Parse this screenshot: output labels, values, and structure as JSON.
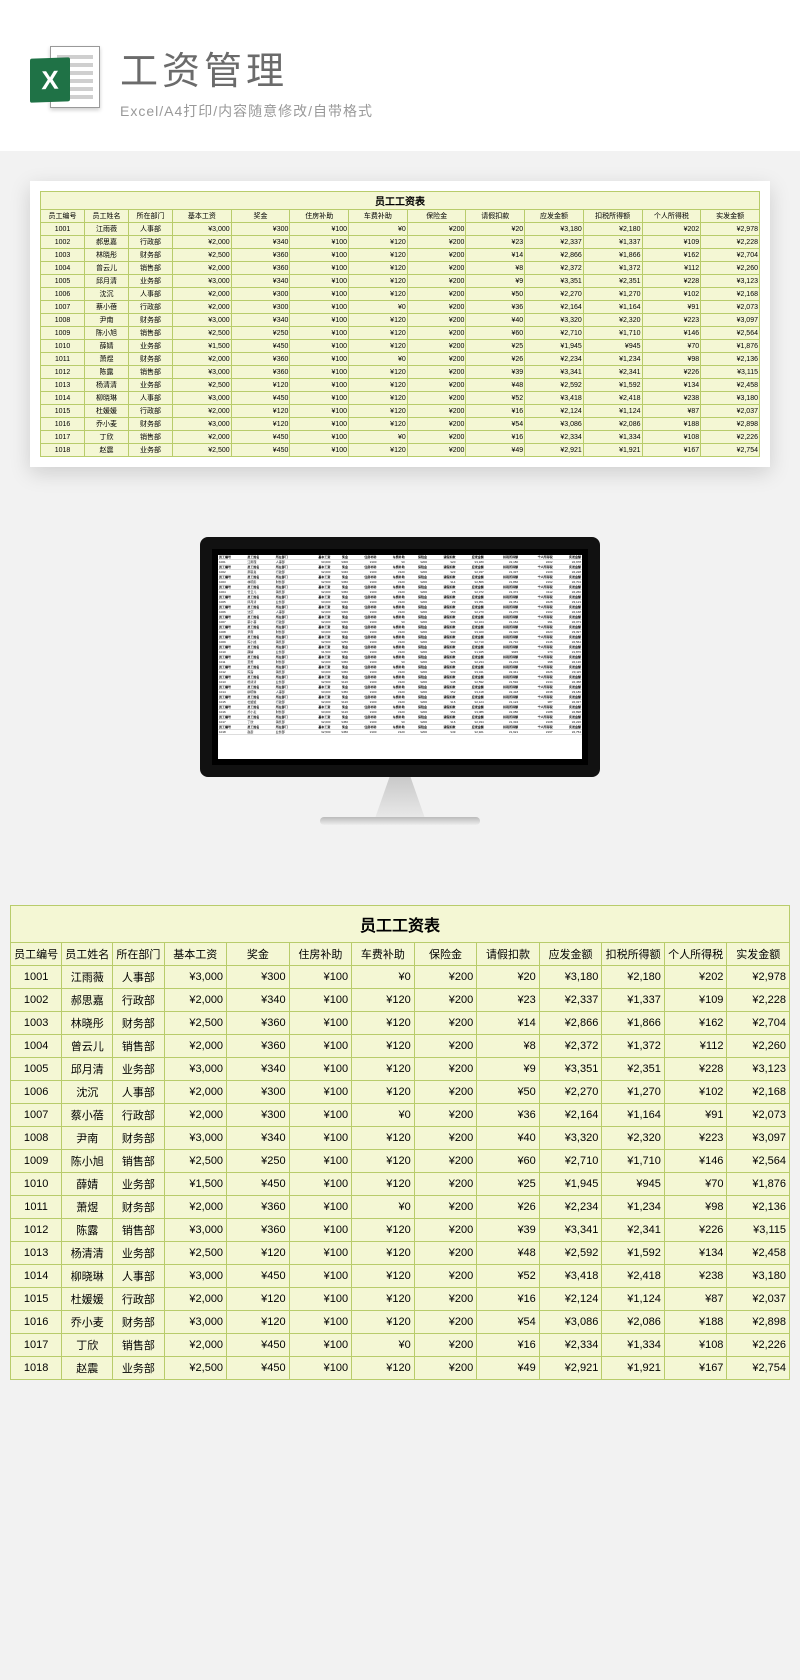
{
  "header": {
    "title": "工资管理",
    "subtitle": "Excel/A4打印/内容随意修改/自带格式",
    "icon_letter": "X"
  },
  "table": {
    "title": "员工工资表",
    "columns": [
      "员工编号",
      "员工姓名",
      "所在部门",
      "基本工资",
      "奖金",
      "住房补助",
      "车费补助",
      "保险金",
      "请假扣款",
      "应发金额",
      "扣税所得额",
      "个人所得税",
      "实发金额"
    ],
    "rows": [
      [
        "1001",
        "江雨薇",
        "人事部",
        "¥3,000",
        "¥300",
        "¥100",
        "¥0",
        "¥200",
        "¥20",
        "¥3,180",
        "¥2,180",
        "¥202",
        "¥2,978"
      ],
      [
        "1002",
        "郝思嘉",
        "行政部",
        "¥2,000",
        "¥340",
        "¥100",
        "¥120",
        "¥200",
        "¥23",
        "¥2,337",
        "¥1,337",
        "¥109",
        "¥2,228"
      ],
      [
        "1003",
        "林晓彤",
        "财务部",
        "¥2,500",
        "¥360",
        "¥100",
        "¥120",
        "¥200",
        "¥14",
        "¥2,866",
        "¥1,866",
        "¥162",
        "¥2,704"
      ],
      [
        "1004",
        "曾云儿",
        "销售部",
        "¥2,000",
        "¥360",
        "¥100",
        "¥120",
        "¥200",
        "¥8",
        "¥2,372",
        "¥1,372",
        "¥112",
        "¥2,260"
      ],
      [
        "1005",
        "邱月清",
        "业务部",
        "¥3,000",
        "¥340",
        "¥100",
        "¥120",
        "¥200",
        "¥9",
        "¥3,351",
        "¥2,351",
        "¥228",
        "¥3,123"
      ],
      [
        "1006",
        "沈沉",
        "人事部",
        "¥2,000",
        "¥300",
        "¥100",
        "¥120",
        "¥200",
        "¥50",
        "¥2,270",
        "¥1,270",
        "¥102",
        "¥2,168"
      ],
      [
        "1007",
        "蔡小蓓",
        "行政部",
        "¥2,000",
        "¥300",
        "¥100",
        "¥0",
        "¥200",
        "¥36",
        "¥2,164",
        "¥1,164",
        "¥91",
        "¥2,073"
      ],
      [
        "1008",
        "尹南",
        "财务部",
        "¥3,000",
        "¥340",
        "¥100",
        "¥120",
        "¥200",
        "¥40",
        "¥3,320",
        "¥2,320",
        "¥223",
        "¥3,097"
      ],
      [
        "1009",
        "陈小旭",
        "销售部",
        "¥2,500",
        "¥250",
        "¥100",
        "¥120",
        "¥200",
        "¥60",
        "¥2,710",
        "¥1,710",
        "¥146",
        "¥2,564"
      ],
      [
        "1010",
        "薛婧",
        "业务部",
        "¥1,500",
        "¥450",
        "¥100",
        "¥120",
        "¥200",
        "¥25",
        "¥1,945",
        "¥945",
        "¥70",
        "¥1,876"
      ],
      [
        "1011",
        "萧煜",
        "财务部",
        "¥2,000",
        "¥360",
        "¥100",
        "¥0",
        "¥200",
        "¥26",
        "¥2,234",
        "¥1,234",
        "¥98",
        "¥2,136"
      ],
      [
        "1012",
        "陈露",
        "销售部",
        "¥3,000",
        "¥360",
        "¥100",
        "¥120",
        "¥200",
        "¥39",
        "¥3,341",
        "¥2,341",
        "¥226",
        "¥3,115"
      ],
      [
        "1013",
        "杨清清",
        "业务部",
        "¥2,500",
        "¥120",
        "¥100",
        "¥120",
        "¥200",
        "¥48",
        "¥2,592",
        "¥1,592",
        "¥134",
        "¥2,458"
      ],
      [
        "1014",
        "柳晓琳",
        "人事部",
        "¥3,000",
        "¥450",
        "¥100",
        "¥120",
        "¥200",
        "¥52",
        "¥3,418",
        "¥2,418",
        "¥238",
        "¥3,180"
      ],
      [
        "1015",
        "杜媛媛",
        "行政部",
        "¥2,000",
        "¥120",
        "¥100",
        "¥120",
        "¥200",
        "¥16",
        "¥2,124",
        "¥1,124",
        "¥87",
        "¥2,037"
      ],
      [
        "1016",
        "乔小麦",
        "财务部",
        "¥3,000",
        "¥120",
        "¥100",
        "¥120",
        "¥200",
        "¥54",
        "¥3,086",
        "¥2,086",
        "¥188",
        "¥2,898"
      ],
      [
        "1017",
        "丁欣",
        "销售部",
        "¥2,000",
        "¥450",
        "¥100",
        "¥0",
        "¥200",
        "¥16",
        "¥2,334",
        "¥1,334",
        "¥108",
        "¥2,226"
      ],
      [
        "1018",
        "赵震",
        "业务部",
        "¥2,500",
        "¥450",
        "¥100",
        "¥120",
        "¥200",
        "¥49",
        "¥2,921",
        "¥1,921",
        "¥167",
        "¥2,754"
      ]
    ]
  }
}
